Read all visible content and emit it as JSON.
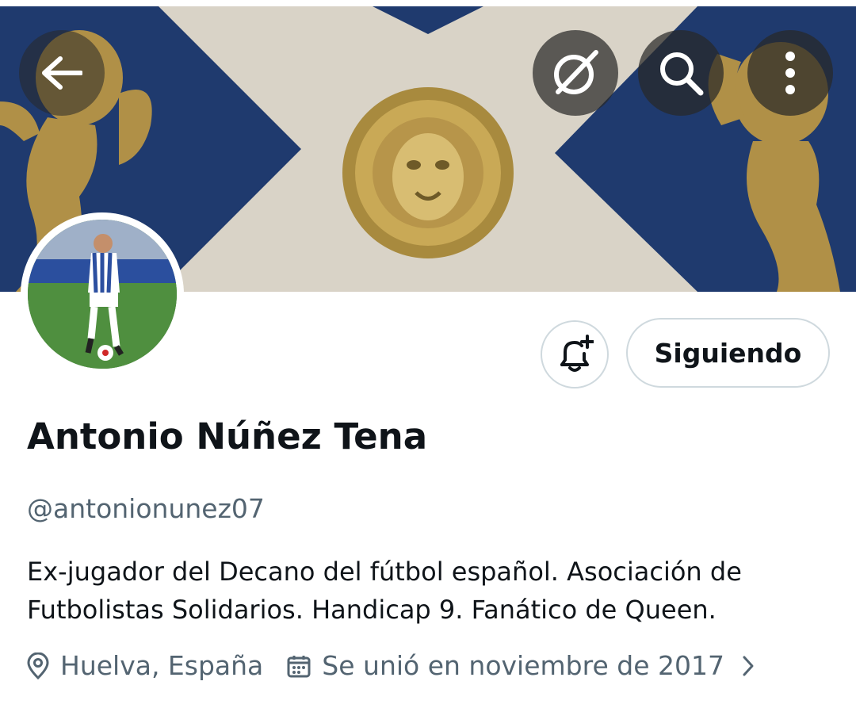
{
  "header": {
    "back_icon": "arrow-left-icon",
    "grok_icon": "grok-icon",
    "search_icon": "search-icon",
    "more_icon": "more-vertical-icon"
  },
  "profile": {
    "name": "Antonio Núñez Tena",
    "handle": "@antonionunez07",
    "bio": "Ex-jugador del Decano del fútbol español. Asociación de Futbolistas Solidarios. Handicap 9. Fanático de Queen.",
    "location": "Huelva, España",
    "joined": "Se unió en noviembre de 2017"
  },
  "actions": {
    "follow_label": "Siguiendo",
    "notify_icon": "bell-plus-icon"
  },
  "colors": {
    "text_primary": "#0f1419",
    "text_secondary": "#536471",
    "border": "#cfd9de",
    "banner_blue": "#1f3a6e"
  }
}
